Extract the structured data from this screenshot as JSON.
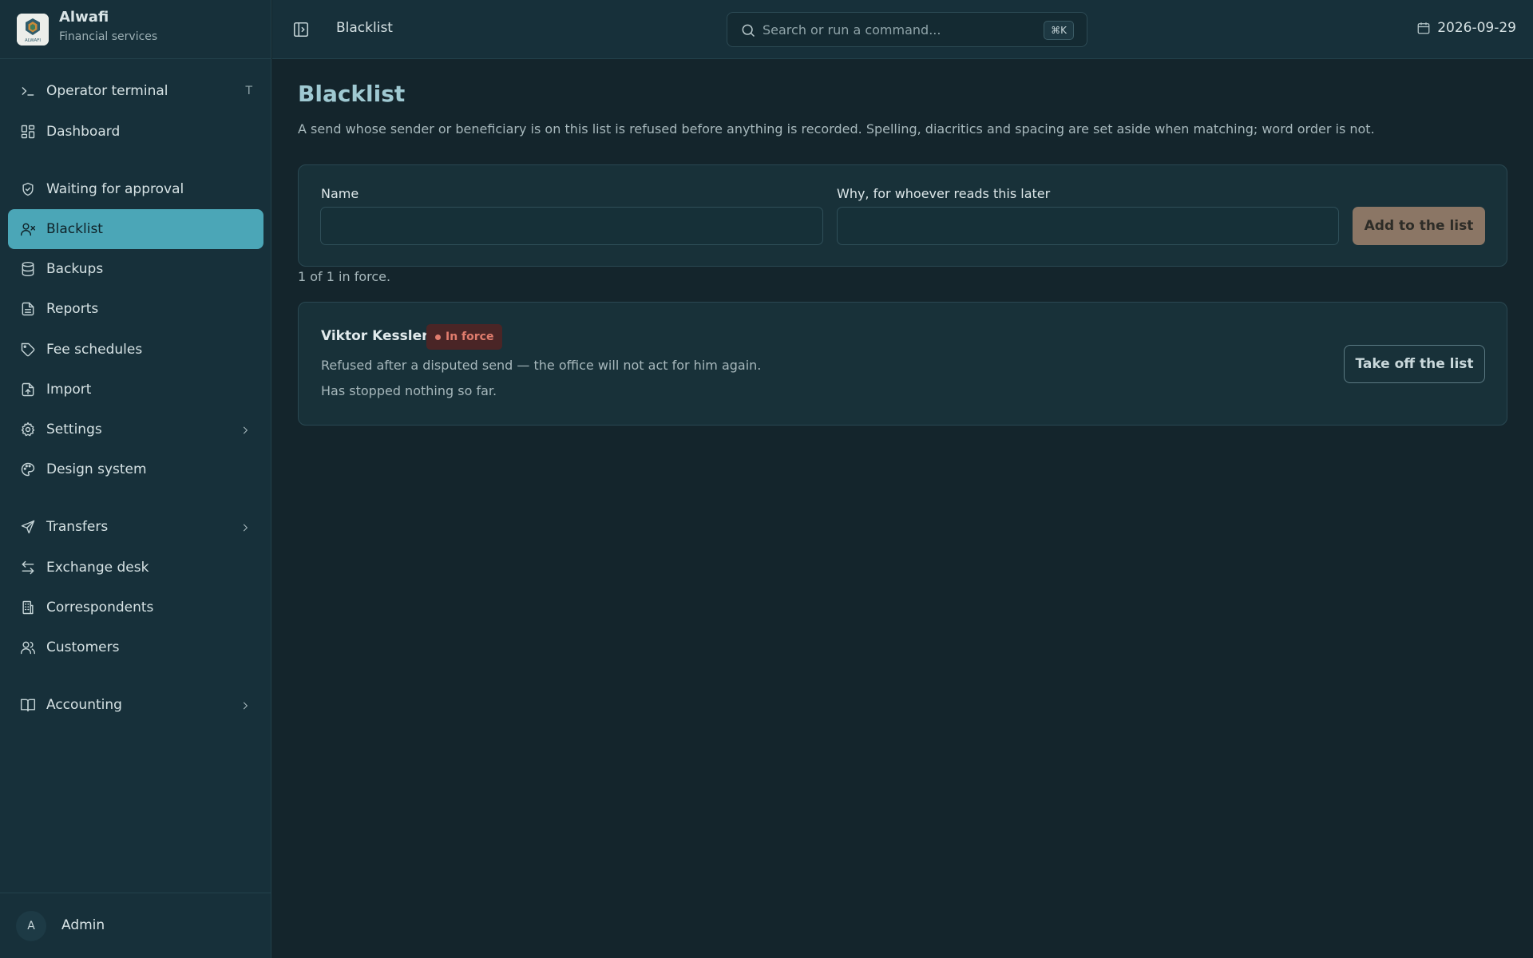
{
  "brand": {
    "name": "Alwafi",
    "subtitle": "Financial services",
    "logo_text": "ALWAFI"
  },
  "sidebar": {
    "items": [
      {
        "label": "Operator terminal",
        "icon": "terminal-icon",
        "shortcut": "T"
      },
      {
        "label": "Dashboard",
        "icon": "dashboard-icon"
      },
      {
        "label": "Waiting for approval",
        "icon": "shield-check-icon"
      },
      {
        "label": "Blacklist",
        "icon": "user-x-icon",
        "active": true
      },
      {
        "label": "Backups",
        "icon": "database-icon"
      },
      {
        "label": "Reports",
        "icon": "file-text-icon"
      },
      {
        "label": "Fee schedules",
        "icon": "tag-icon"
      },
      {
        "label": "Import",
        "icon": "file-upload-icon"
      },
      {
        "label": "Settings",
        "icon": "gear-icon",
        "expandable": true
      },
      {
        "label": "Design system",
        "icon": "palette-icon"
      },
      {
        "label": "Transfers",
        "icon": "send-icon",
        "expandable": true
      },
      {
        "label": "Exchange desk",
        "icon": "arrows-exchange-icon"
      },
      {
        "label": "Correspondents",
        "icon": "building-icon"
      },
      {
        "label": "Customers",
        "icon": "users-icon"
      },
      {
        "label": "Accounting",
        "icon": "book-open-icon",
        "expandable": true
      }
    ],
    "user": {
      "initial": "A",
      "name": "Admin"
    }
  },
  "topbar": {
    "breadcrumb": "Blacklist",
    "search_placeholder": "Search or run a command...",
    "search_shortcut": "⌘K",
    "date": "2026-09-29"
  },
  "main": {
    "title": "Blacklist",
    "description": "A send whose sender or beneficiary is on this list is refused before anything is recorded. Spelling, diacritics and spacing are set aside when matching; word order is not.",
    "form": {
      "name_label": "Name",
      "name_value": "",
      "reason_label": "Why, for whoever reads this later",
      "reason_value": "",
      "add_button": "Add to the list"
    },
    "count_text": "1 of 1 in force.",
    "entries": [
      {
        "name": "Viktor Kessler",
        "status": "In force",
        "reason": "Refused after a disputed send — the office will not act for him again.",
        "stat": "Has stopped nothing so far.",
        "remove_button": "Take off the list"
      }
    ]
  },
  "colors": {
    "accent": "#4ba6b7",
    "background": "#14252c",
    "sidebar": "#17303a",
    "add_button": "#8b7665",
    "badge_danger": "#e07c6d"
  }
}
